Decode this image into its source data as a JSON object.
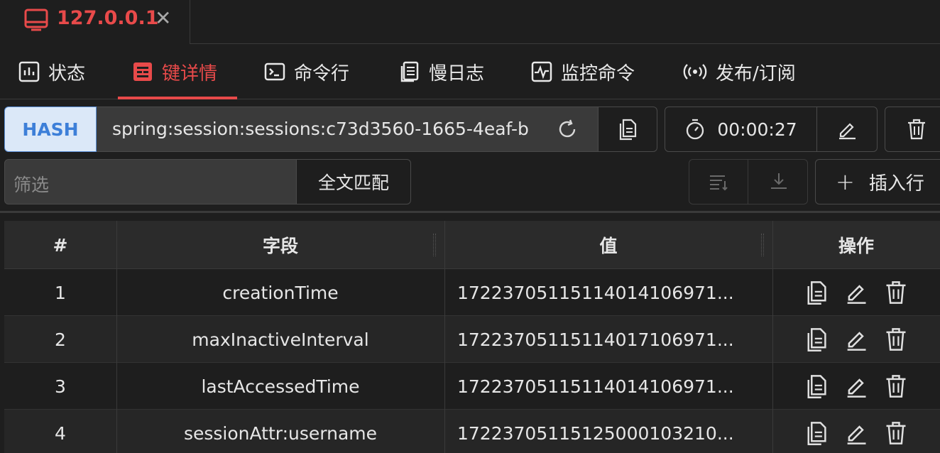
{
  "connection": {
    "host": "127.0.0.1"
  },
  "tabs": [
    {
      "label": "状态"
    },
    {
      "label": "键详情"
    },
    {
      "label": "命令行"
    },
    {
      "label": "慢日志"
    },
    {
      "label": "监控命令"
    },
    {
      "label": "发布/订阅"
    }
  ],
  "key": {
    "type": "HASH",
    "name": "spring:session:sessions:c73d3560-1665-4eaf-b",
    "ttl": "00:00:27"
  },
  "filter": {
    "placeholder": "筛选",
    "fulltext_label": "全文匹配",
    "insert_label": "插入行"
  },
  "table": {
    "columns": [
      "#",
      "字段",
      "值",
      "操作"
    ],
    "rows": [
      {
        "index": "1",
        "field": "creationTime",
        "value": "17223705115114014106971..."
      },
      {
        "index": "2",
        "field": "maxInactiveInterval",
        "value": "17223705115114017106971..."
      },
      {
        "index": "3",
        "field": "lastAccessedTime",
        "value": "17223705115114014106971..."
      },
      {
        "index": "4",
        "field": "sessionAttr:username",
        "value": "17223705115125000103210..."
      }
    ]
  },
  "colors": {
    "accent": "#e84a4a",
    "hash_badge": "#3d7fd8",
    "background": "#1e1e1e"
  }
}
